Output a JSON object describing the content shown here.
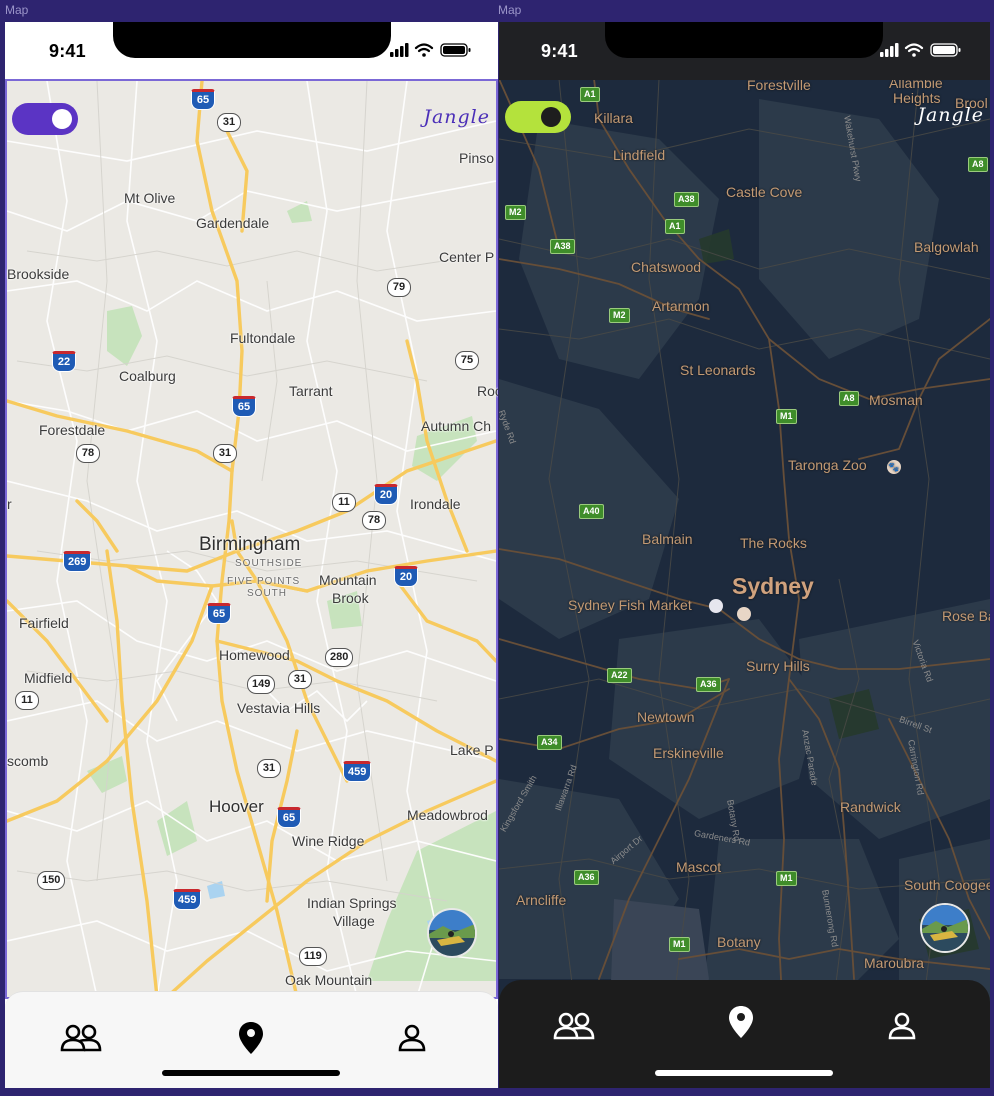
{
  "frames": [
    {
      "label": "Map",
      "theme": "light",
      "status_time": "9:41",
      "logo": "Jangle",
      "toggle_color": "#5b34c4",
      "map_labels": [
        "Pinso",
        "Mt Olive",
        "Gardendale",
        "Center P",
        "Brookside",
        "Fultondale",
        "Coalburg",
        "Tarrant",
        "Roc",
        "Forestdale",
        "Autumn Ch",
        "Irondale",
        "Birmingham",
        "SOUTHSIDE",
        "FIVE POINTS",
        "SOUTH",
        "Mountain",
        "Brook",
        "Fairfield",
        "Homewood",
        "Midfield",
        "Vestavia Hills",
        "Lake P",
        "scomb",
        "Hoover",
        "Meadowbrod",
        "Wine Ridge",
        "Indian Springs",
        "Village",
        "Oak Mountain",
        "r"
      ],
      "route_shields": [
        "65",
        "31",
        "79",
        "22",
        "75",
        "65",
        "78",
        "31",
        "11",
        "20",
        "78",
        "20",
        "269",
        "65",
        "280",
        "149",
        "31",
        "11",
        "31",
        "459",
        "65",
        "150",
        "459",
        "119"
      ],
      "tabs": [
        "friends-icon",
        "map-pin-icon",
        "profile-icon"
      ]
    },
    {
      "label": "Map",
      "theme": "dark",
      "status_time": "9:41",
      "logo": "Jangle",
      "toggle_color": "#b4e23c",
      "map_labels": [
        "Forestville",
        "Allambie",
        "Heights",
        "Brool",
        "Killara",
        "Lindfield",
        "Castle Cove",
        "Balgowlah",
        "Chatswood",
        "Artarmon",
        "St Leonards",
        "Mosman",
        "Taronga Zoo",
        "Balmain",
        "The Rocks",
        "Sydney",
        "Sydney Fish Market",
        "Rose Ba",
        "Surry Hills",
        "Newtown",
        "Erskineville",
        "Randwick",
        "Mascot",
        "South Coogee",
        "Arncliffe",
        "Botany",
        "Maroubra"
      ],
      "road_badges": [
        "A1",
        "A8",
        "M2",
        "A38",
        "A38",
        "A1",
        "M2",
        "A8",
        "M1",
        "A40",
        "A22",
        "A36",
        "A34",
        "A36",
        "M1",
        "M1"
      ],
      "street_labels": [
        "Ryde Rd",
        "Wakehurst Pkwy",
        "Victoria Rd",
        "Birrell St",
        "Carrington Rd",
        "Anzac Parade",
        "Botany Rd",
        "Gardeners Rd",
        "Bunnerong Rd",
        "Airport Dr",
        "Illawarra Rd",
        "Kingsford Smith"
      ],
      "tabs": [
        "friends-icon",
        "map-pin-icon",
        "profile-icon"
      ]
    }
  ]
}
